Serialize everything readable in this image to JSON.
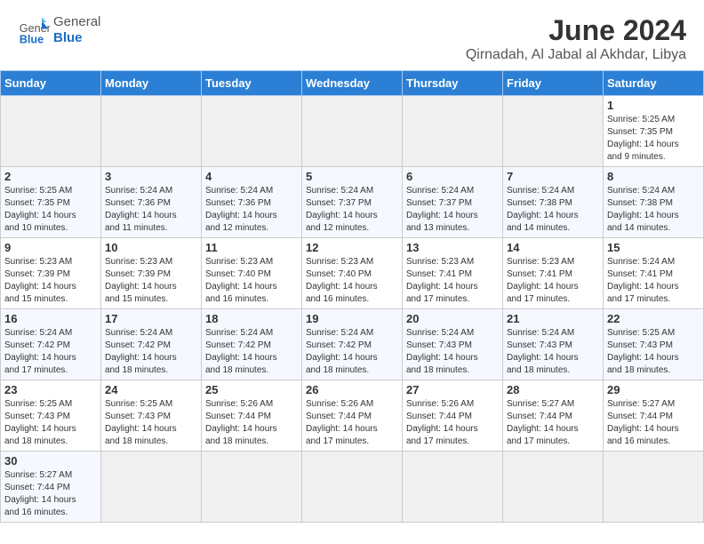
{
  "header": {
    "logo_general": "General",
    "logo_blue": "Blue",
    "title": "June 2024",
    "subtitle": "Qirnadah, Al Jabal al Akhdar, Libya"
  },
  "weekdays": [
    "Sunday",
    "Monday",
    "Tuesday",
    "Wednesday",
    "Thursday",
    "Friday",
    "Saturday"
  ],
  "weeks": [
    [
      {
        "day": "",
        "info": ""
      },
      {
        "day": "",
        "info": ""
      },
      {
        "day": "",
        "info": ""
      },
      {
        "day": "",
        "info": ""
      },
      {
        "day": "",
        "info": ""
      },
      {
        "day": "",
        "info": ""
      },
      {
        "day": "1",
        "info": "Sunrise: 5:25 AM\nSunset: 7:35 PM\nDaylight: 14 hours\nand 9 minutes."
      }
    ],
    [
      {
        "day": "2",
        "info": "Sunrise: 5:25 AM\nSunset: 7:35 PM\nDaylight: 14 hours\nand 10 minutes."
      },
      {
        "day": "3",
        "info": "Sunrise: 5:24 AM\nSunset: 7:36 PM\nDaylight: 14 hours\nand 11 minutes."
      },
      {
        "day": "4",
        "info": "Sunrise: 5:24 AM\nSunset: 7:36 PM\nDaylight: 14 hours\nand 12 minutes."
      },
      {
        "day": "5",
        "info": "Sunrise: 5:24 AM\nSunset: 7:37 PM\nDaylight: 14 hours\nand 12 minutes."
      },
      {
        "day": "6",
        "info": "Sunrise: 5:24 AM\nSunset: 7:37 PM\nDaylight: 14 hours\nand 13 minutes."
      },
      {
        "day": "7",
        "info": "Sunrise: 5:24 AM\nSunset: 7:38 PM\nDaylight: 14 hours\nand 14 minutes."
      },
      {
        "day": "8",
        "info": "Sunrise: 5:24 AM\nSunset: 7:38 PM\nDaylight: 14 hours\nand 14 minutes."
      }
    ],
    [
      {
        "day": "9",
        "info": "Sunrise: 5:23 AM\nSunset: 7:39 PM\nDaylight: 14 hours\nand 15 minutes."
      },
      {
        "day": "10",
        "info": "Sunrise: 5:23 AM\nSunset: 7:39 PM\nDaylight: 14 hours\nand 15 minutes."
      },
      {
        "day": "11",
        "info": "Sunrise: 5:23 AM\nSunset: 7:40 PM\nDaylight: 14 hours\nand 16 minutes."
      },
      {
        "day": "12",
        "info": "Sunrise: 5:23 AM\nSunset: 7:40 PM\nDaylight: 14 hours\nand 16 minutes."
      },
      {
        "day": "13",
        "info": "Sunrise: 5:23 AM\nSunset: 7:41 PM\nDaylight: 14 hours\nand 17 minutes."
      },
      {
        "day": "14",
        "info": "Sunrise: 5:23 AM\nSunset: 7:41 PM\nDaylight: 14 hours\nand 17 minutes."
      },
      {
        "day": "15",
        "info": "Sunrise: 5:24 AM\nSunset: 7:41 PM\nDaylight: 14 hours\nand 17 minutes."
      }
    ],
    [
      {
        "day": "16",
        "info": "Sunrise: 5:24 AM\nSunset: 7:42 PM\nDaylight: 14 hours\nand 17 minutes."
      },
      {
        "day": "17",
        "info": "Sunrise: 5:24 AM\nSunset: 7:42 PM\nDaylight: 14 hours\nand 18 minutes."
      },
      {
        "day": "18",
        "info": "Sunrise: 5:24 AM\nSunset: 7:42 PM\nDaylight: 14 hours\nand 18 minutes."
      },
      {
        "day": "19",
        "info": "Sunrise: 5:24 AM\nSunset: 7:42 PM\nDaylight: 14 hours\nand 18 minutes."
      },
      {
        "day": "20",
        "info": "Sunrise: 5:24 AM\nSunset: 7:43 PM\nDaylight: 14 hours\nand 18 minutes."
      },
      {
        "day": "21",
        "info": "Sunrise: 5:24 AM\nSunset: 7:43 PM\nDaylight: 14 hours\nand 18 minutes."
      },
      {
        "day": "22",
        "info": "Sunrise: 5:25 AM\nSunset: 7:43 PM\nDaylight: 14 hours\nand 18 minutes."
      }
    ],
    [
      {
        "day": "23",
        "info": "Sunrise: 5:25 AM\nSunset: 7:43 PM\nDaylight: 14 hours\nand 18 minutes."
      },
      {
        "day": "24",
        "info": "Sunrise: 5:25 AM\nSunset: 7:43 PM\nDaylight: 14 hours\nand 18 minutes."
      },
      {
        "day": "25",
        "info": "Sunrise: 5:26 AM\nSunset: 7:44 PM\nDaylight: 14 hours\nand 18 minutes."
      },
      {
        "day": "26",
        "info": "Sunrise: 5:26 AM\nSunset: 7:44 PM\nDaylight: 14 hours\nand 17 minutes."
      },
      {
        "day": "27",
        "info": "Sunrise: 5:26 AM\nSunset: 7:44 PM\nDaylight: 14 hours\nand 17 minutes."
      },
      {
        "day": "28",
        "info": "Sunrise: 5:27 AM\nSunset: 7:44 PM\nDaylight: 14 hours\nand 17 minutes."
      },
      {
        "day": "29",
        "info": "Sunrise: 5:27 AM\nSunset: 7:44 PM\nDaylight: 14 hours\nand 16 minutes."
      }
    ],
    [
      {
        "day": "30",
        "info": "Sunrise: 5:27 AM\nSunset: 7:44 PM\nDaylight: 14 hours\nand 16 minutes."
      },
      {
        "day": "",
        "info": ""
      },
      {
        "day": "",
        "info": ""
      },
      {
        "day": "",
        "info": ""
      },
      {
        "day": "",
        "info": ""
      },
      {
        "day": "",
        "info": ""
      },
      {
        "day": "",
        "info": ""
      }
    ]
  ]
}
